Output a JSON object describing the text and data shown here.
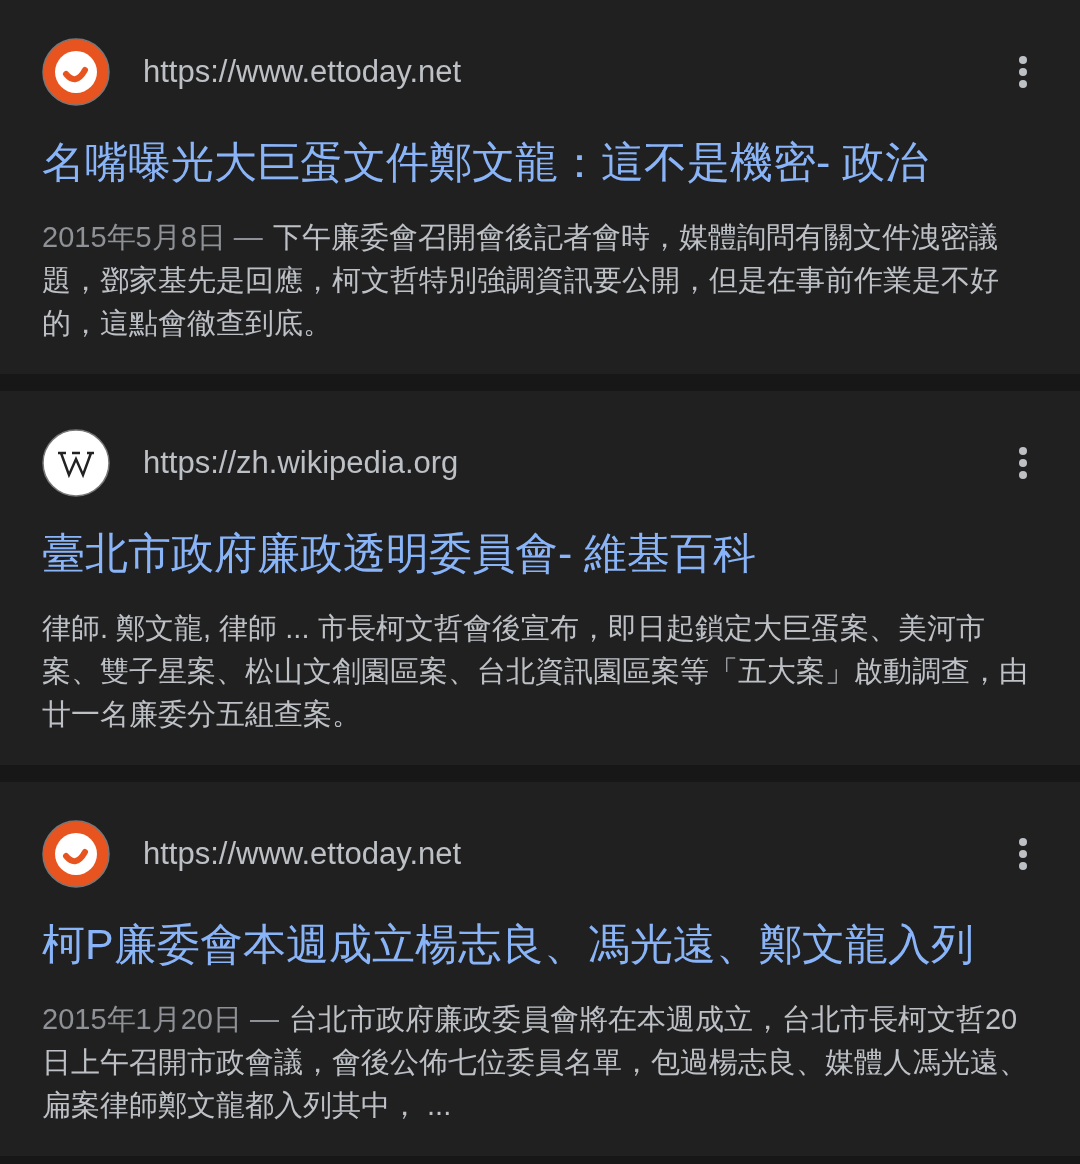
{
  "results": [
    {
      "kind": "ettoday",
      "url": "https://www.ettoday.net",
      "title": "名嘴曝光大巨蛋文件鄭文龍：這不是機密- 政治",
      "date": "2015年5月8日 —",
      "snippet": "下午廉委會召開會後記者會時，媒體詢問有關文件洩密議題，鄧家基先是回應，柯文哲特別強調資訊要公開，但是在事前作業是不好的，這點會徹查到底。"
    },
    {
      "kind": "wikipedia",
      "url": "https://zh.wikipedia.org",
      "title": "臺北市政府廉政透明委員會- 維基百科",
      "snippet": "律師. 鄭文龍, 律師 ... 市長柯文哲會後宣布，即日起鎖定大巨蛋案、美河市案、雙子星案、松山文創園區案、台北資訊園區案等「五大案」啟動調查，由廿一名廉委分五組查案。"
    },
    {
      "kind": "ettoday",
      "url": "https://www.ettoday.net",
      "title": "柯P廉委會本週成立楊志良、馮光遠、鄭文龍入列",
      "date": "2015年1月20日 —",
      "snippet": "台北市政府廉政委員會將在本週成立，台北市長柯文哲20日上午召開市政會議，會後公佈七位委員名單，包過楊志良、媒體人馮光遠、扁案律師鄭文龍都入列其中， ..."
    }
  ]
}
